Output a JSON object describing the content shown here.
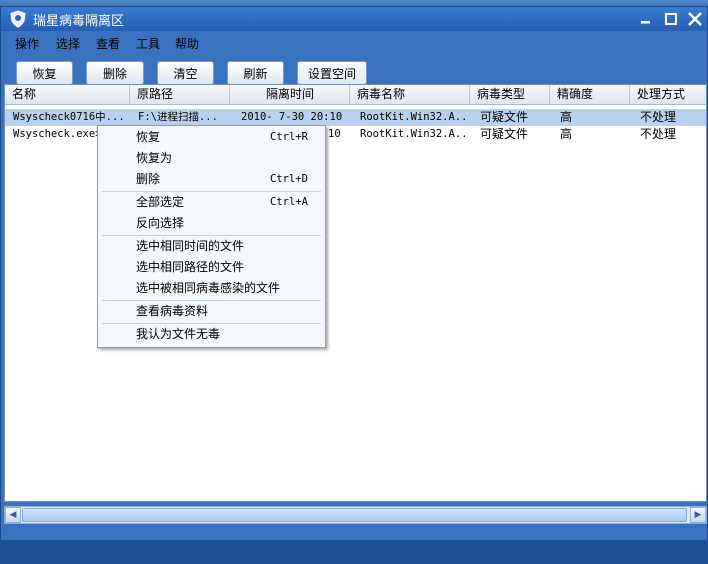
{
  "window": {
    "title": "瑞星病毒隔离区",
    "controls": [
      "minimize-icon",
      "maximize-icon",
      "close-icon"
    ]
  },
  "menu": [
    "操作",
    "选择",
    "查看",
    "工具",
    "帮助"
  ],
  "toolbar": {
    "restore": "恢复",
    "delete": "删除",
    "clear": "清空",
    "refresh": "刷新",
    "settings": "设置空间"
  },
  "table": {
    "columns": [
      "名称",
      "原路径",
      "隔离时间",
      "病毒名称",
      "病毒类型",
      "精确度",
      "处理方式"
    ],
    "rows": [
      {
        "name": "Wsyscheck0716中...",
        "path": "F:\\进程扫描...",
        "time": "2010- 7-30 20:10",
        "virus": "RootKit.Win32.A...",
        "type": "可疑文件",
        "accuracy": "高",
        "action": "不处理",
        "selected": true
      },
      {
        "name": "Wsyscheck.exe>",
        "path": "",
        "time": "10",
        "virus": "RootKit.Win32.A...",
        "type": "可疑文件",
        "accuracy": "高",
        "action": "不处理",
        "selected": false
      }
    ]
  },
  "context_menu": {
    "restore": "恢复",
    "restore_sc": "Ctrl+R",
    "restore_as": "恢复为",
    "delete": "删除",
    "delete_sc": "Ctrl+D",
    "select_all": "全部选定",
    "select_all_sc": "Ctrl+A",
    "invert": "反向选择",
    "same_time": "选中相同时间的文件",
    "same_path": "选中相同路径的文件",
    "same_virus": "选中被相同病毒感染的文件",
    "virus_info": "查看病毒资料",
    "not_virus": "我认为文件无毒"
  },
  "colors": {
    "window_bg": "#3b72c0",
    "selection": "#b7d1ee",
    "menu_bg": "#f4f7fb"
  }
}
